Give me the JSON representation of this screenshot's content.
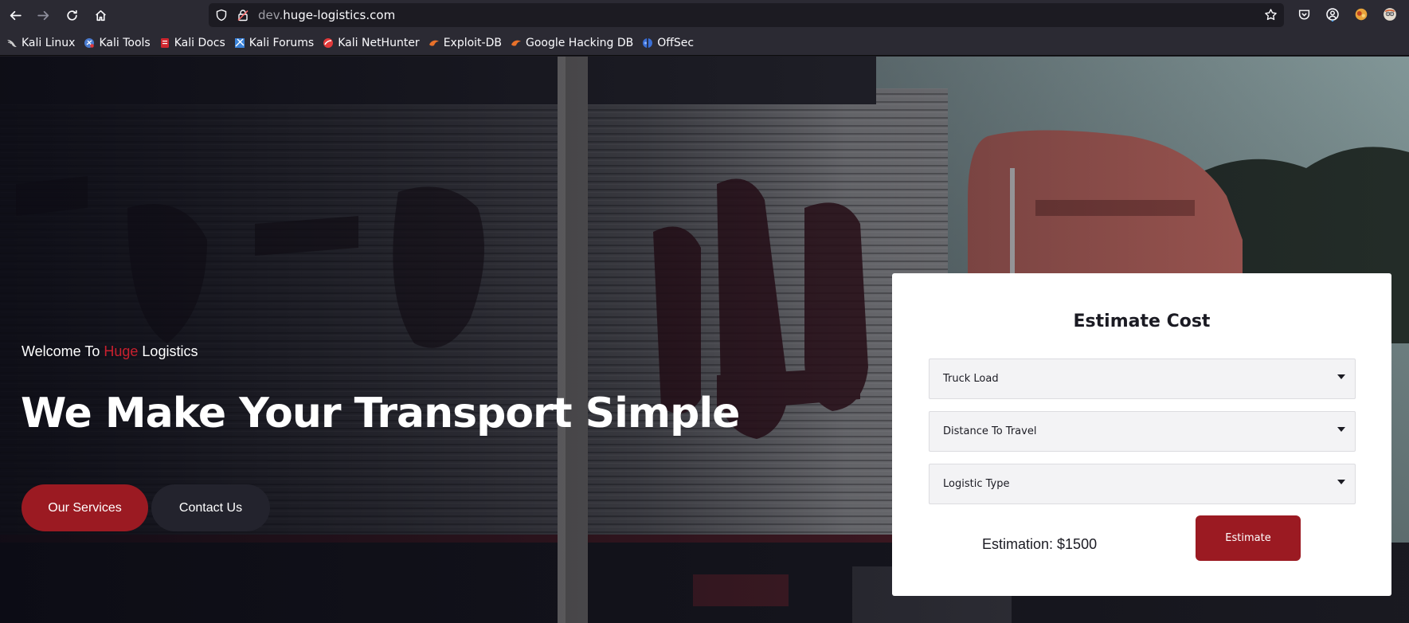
{
  "browser": {
    "url_prefix": "dev.",
    "url_domain": "huge-logistics.com",
    "bookmarks": [
      {
        "label": "Kali Linux",
        "icon": "kali-dragon-icon",
        "color": "#cfcfcf"
      },
      {
        "label": "Kali Tools",
        "icon": "kali-tools-icon",
        "color": "#4a7bd0"
      },
      {
        "label": "Kali Docs",
        "icon": "kali-docs-icon",
        "color": "#d0262f"
      },
      {
        "label": "Kali Forums",
        "icon": "kali-forums-icon",
        "color": "#3a82d9"
      },
      {
        "label": "Kali NetHunter",
        "icon": "nethunter-icon",
        "color": "#e2393a"
      },
      {
        "label": "Exploit-DB",
        "icon": "exploit-db-icon",
        "color": "#e8712a"
      },
      {
        "label": "Google Hacking DB",
        "icon": "ghdb-icon",
        "color": "#e8712a"
      },
      {
        "label": "OffSec",
        "icon": "offsec-icon",
        "color": "#3b6fd6"
      }
    ]
  },
  "hero": {
    "welcome_prefix": "Welcome To ",
    "welcome_accent": "Huge",
    "welcome_suffix": " Logistics",
    "headline": "We Make Your Transport Simple",
    "services_label": "Our Services",
    "contact_label": "Contact Us"
  },
  "estimate": {
    "title": "Estimate Cost",
    "selects": [
      {
        "value": "Truck Load"
      },
      {
        "value": "Distance To Travel"
      },
      {
        "value": "Logistic Type"
      }
    ],
    "estimation_text": "Estimation: $1500",
    "button_label": "Estimate"
  },
  "colors": {
    "accent": "#9b1a22",
    "accent_text": "#c8202e",
    "chrome_bg": "#2b2a33"
  }
}
